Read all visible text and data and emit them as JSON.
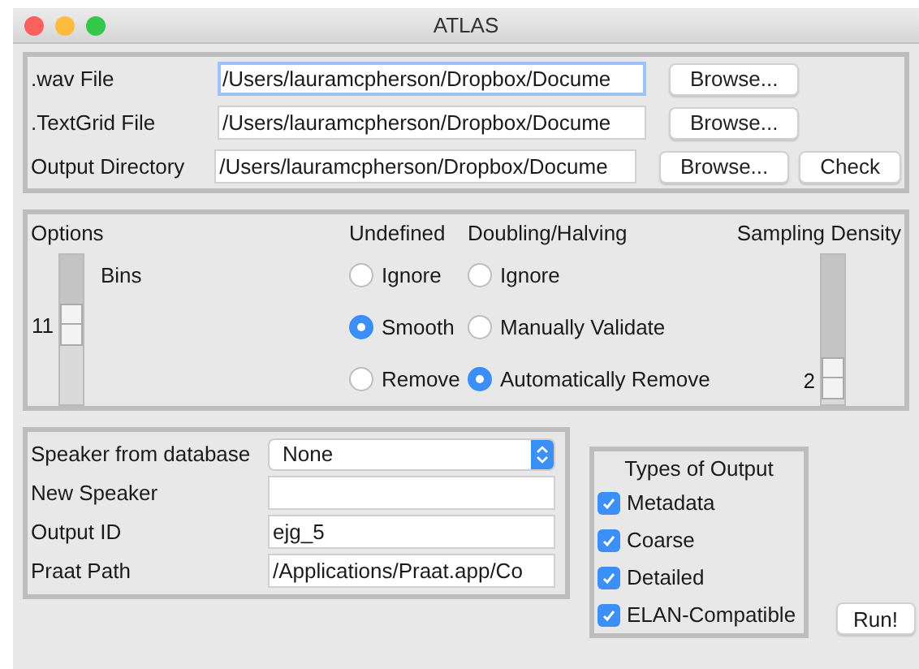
{
  "window": {
    "title": "ATLAS"
  },
  "file_rows": [
    {
      "label": ".wav File",
      "value": "/Users/lauramcpherson/Dropbox/Docume",
      "focused": true,
      "buttons": [
        "Browse..."
      ]
    },
    {
      "label": ".TextGrid File",
      "value": "/Users/lauramcpherson/Dropbox/Docume",
      "focused": false,
      "buttons": [
        "Browse..."
      ]
    },
    {
      "label": "Output Directory",
      "value": "/Users/lauramcpherson/Dropbox/Docume",
      "focused": false,
      "buttons": [
        "Browse...",
        "Check"
      ]
    }
  ],
  "options": {
    "title": "Options",
    "bins": {
      "label": "Bins",
      "reading": "11",
      "level": 0.61
    },
    "undefined": {
      "heading": "Undefined",
      "choices": [
        {
          "label": "Ignore",
          "selected": false
        },
        {
          "label": "Smooth",
          "selected": true
        },
        {
          "label": "Remove",
          "selected": false
        }
      ]
    },
    "doubling": {
      "heading": "Doubling/Halving",
      "choices": [
        {
          "label": "Ignore",
          "selected": false
        },
        {
          "label": "Manually Validate",
          "selected": false
        },
        {
          "label": "Automatically Remove",
          "selected": true
        }
      ]
    },
    "sampling": {
      "heading": "Sampling Density",
      "reading": "2",
      "level": 0.97
    }
  },
  "speaker_fields": [
    {
      "label": "Speaker from database",
      "kind": "select",
      "value": "None"
    },
    {
      "label": "New Speaker",
      "kind": "text"
    },
    {
      "label": "Output ID",
      "kind": "text",
      "value": "ejg_5"
    },
    {
      "label": "Praat Path",
      "kind": "text",
      "value": "/Applications/Praat.app/Co"
    }
  ],
  "output_types": {
    "title": "Types of Output",
    "items": [
      {
        "label": "Metadata",
        "checked": true
      },
      {
        "label": "Coarse",
        "checked": true
      },
      {
        "label": "Detailed",
        "checked": true
      },
      {
        "label": "ELAN-Compatible",
        "checked": true
      }
    ]
  },
  "run_button": "Run!"
}
